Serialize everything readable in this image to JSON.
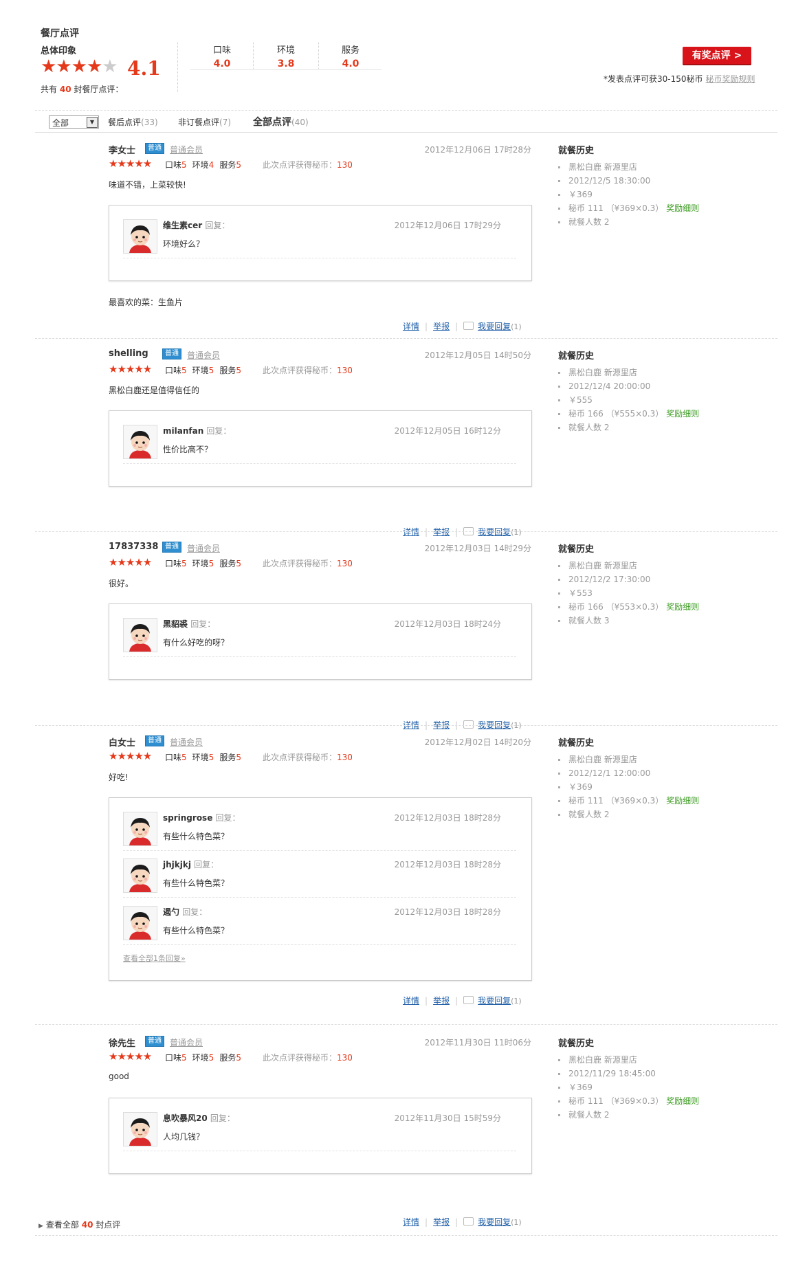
{
  "header": {
    "title": "餐厅点评",
    "overall_label": "总体印象",
    "overall_score": "4.1",
    "stars_full": "★★★★",
    "stars_empty": "★",
    "count_prefix": "共有",
    "count": "40",
    "count_suffix": "封餐厅点评：",
    "subscores": [
      {
        "label": "口味",
        "value": "4.0"
      },
      {
        "label": "环境",
        "value": "3.8"
      },
      {
        "label": "服务",
        "value": "4.0"
      }
    ],
    "prize_button": "有奖点评 >",
    "prize_note": "*发表点评可获30-150秘币",
    "prize_rule": "秘币奖励规则"
  },
  "filter": {
    "select_value": "全部",
    "tabs": [
      {
        "label": "餐后点评",
        "count": "(33)"
      },
      {
        "label": "非订餐点评",
        "count": "(7)"
      },
      {
        "label": "全部点评",
        "count": "(40)"
      }
    ]
  },
  "labels": {
    "badge": "普通",
    "level": "普通会员",
    "taste": "口味",
    "env": "环境",
    "service": "服务",
    "coin_label": "此次点评获得秘币：",
    "reply_word": "回复：",
    "detail": "详情",
    "report": "举报",
    "reply_action": "我要回复",
    "history_title": "就餐历史",
    "coin_prefix": "秘币",
    "reward_detail": "奖励细则",
    "diners_prefix": "就餐人数",
    "five_stars": "★★★★★"
  },
  "reviews": [
    {
      "user": "李女士",
      "date": "2012年12月06日 17时28分",
      "taste": "5",
      "env": "4",
      "service": "5",
      "coins": "130",
      "text": "味道不错，上菜较快!",
      "replies": [
        {
          "name": "维生素cer",
          "date": "2012年12月06日 17时29分",
          "text": "环境好么？"
        }
      ],
      "extra": "最喜欢的菜：生鱼片",
      "reply_count": "(1)",
      "history": {
        "store": "黑松白鹿 新源里店",
        "time": "2012/12/5 18:30:00",
        "price": "￥369",
        "coins": "111  （¥369×0.3）",
        "diners": "2"
      }
    },
    {
      "user": "shelling",
      "date": "2012年12月05日 14时50分",
      "taste": "5",
      "env": "5",
      "service": "5",
      "coins": "130",
      "text": "黑松白鹿还是值得信任的",
      "replies": [
        {
          "name": "milanfan",
          "date": "2012年12月05日 16时12分",
          "text": "性价比高不？"
        }
      ],
      "reply_count": "(1)",
      "history": {
        "store": "黑松白鹿 新源里店",
        "time": "2012/12/4 20:00:00",
        "price": "￥555",
        "coins": "166  （¥555×0.3）",
        "diners": "2"
      }
    },
    {
      "user": "17837338",
      "date": "2012年12月03日 14时29分",
      "taste": "5",
      "env": "5",
      "service": "5",
      "coins": "130",
      "text": "很好。",
      "replies": [
        {
          "name": "黑貂裘",
          "date": "2012年12月03日 18时24分",
          "text": "有什么好吃的呀？"
        }
      ],
      "reply_count": "(1)",
      "history": {
        "store": "黑松白鹿 新源里店",
        "time": "2012/12/2 17:30:00",
        "price": "￥553",
        "coins": "166  （¥553×0.3）",
        "diners": "3"
      }
    },
    {
      "user": "白女士",
      "date": "2012年12月02日 14时20分",
      "taste": "5",
      "env": "5",
      "service": "5",
      "coins": "130",
      "text": "好吃!",
      "replies": [
        {
          "name": "springrose",
          "date": "2012年12月03日 18时28分",
          "text": "有些什么特色菜？"
        },
        {
          "name": "jhjkjkj",
          "date": "2012年12月03日 18时28分",
          "text": "有些什么特色菜？"
        },
        {
          "name": "遏勺",
          "date": "2012年12月03日 18时28分",
          "text": "有些什么特色菜？"
        }
      ],
      "show_all": "查看全部1条回复»",
      "reply_count": "(1)",
      "history": {
        "store": "黑松白鹿 新源里店",
        "time": "2012/12/1 12:00:00",
        "price": "￥369",
        "coins": "111  （¥369×0.3）",
        "diners": "2"
      }
    },
    {
      "user": "徐先生",
      "date": "2012年11月30日 11时06分",
      "taste": "5",
      "env": "5",
      "service": "5",
      "coins": "130",
      "text": "good",
      "replies": [
        {
          "name": "息吹暴风20",
          "date": "2012年11月30日 15时59分",
          "text": "人均几钱？"
        }
      ],
      "reply_count": "(1)",
      "history": {
        "store": "黑松白鹿 新源里店",
        "time": "2012/11/29 18:45:00",
        "price": "￥369",
        "coins": "111  （¥369×0.3）",
        "diners": "2"
      }
    }
  ],
  "footer": {
    "view_all_prefix": "查看全部",
    "view_all_count": "40",
    "view_all_suffix": "封点评"
  }
}
